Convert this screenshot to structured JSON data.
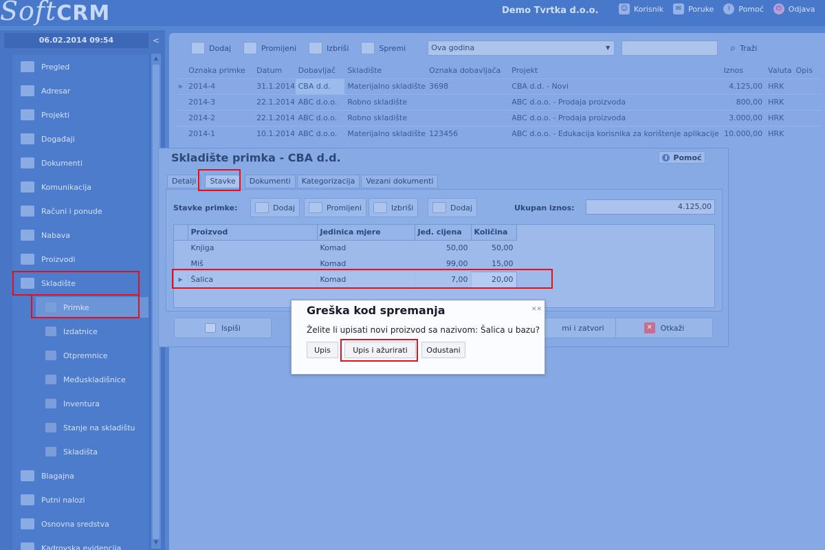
{
  "app": {
    "logo_text": "Soft",
    "logo_accent": "CRM",
    "company": "Demo Tvrtka d.o.o.",
    "top_nav": [
      {
        "label": "Korisnik",
        "icon": "user-icon"
      },
      {
        "label": "Poruke",
        "icon": "messages-icon"
      },
      {
        "label": "Pomoć",
        "icon": "help-icon"
      },
      {
        "label": "Odjava",
        "icon": "logout-icon"
      }
    ]
  },
  "sidebar": {
    "datetime": "06.02.2014 09:54",
    "collapse": "<",
    "items": [
      {
        "label": "Pregled"
      },
      {
        "label": "Adresar"
      },
      {
        "label": "Projekti"
      },
      {
        "label": "Događaji"
      },
      {
        "label": "Dokumenti"
      },
      {
        "label": "Komunikacija"
      },
      {
        "label": "Računi i ponude"
      },
      {
        "label": "Nabava"
      },
      {
        "label": "Proizvodi"
      },
      {
        "label": "Skladište"
      }
    ],
    "subitems": [
      {
        "label": "Primke"
      },
      {
        "label": "Izdatnice"
      },
      {
        "label": "Otpremnice"
      },
      {
        "label": "Međuskladišnice"
      },
      {
        "label": "Inventura"
      },
      {
        "label": "Stanje na skladištu"
      },
      {
        "label": "Skladišta"
      }
    ],
    "items_after": [
      {
        "label": "Blagajna"
      },
      {
        "label": "Putni nalozi"
      },
      {
        "label": "Osnovna sredstva"
      },
      {
        "label": "Kadrovska evidencija"
      }
    ]
  },
  "toolbar": {
    "add": "Dodaj",
    "edit": "Promijeni",
    "delete": "Izbriši",
    "save": "Spremi",
    "period": "Ova godina",
    "search_value": "",
    "search": "Traži"
  },
  "grid": {
    "columns": [
      "Oznaka primke",
      "Datum",
      "Dobavljač",
      "Skladište",
      "Oznaka dobavljača",
      "Projekt",
      "Iznos",
      "Valuta",
      "Opis"
    ],
    "rows": [
      [
        "2014-4",
        "31.1.2014",
        "CBA d.d.",
        "Materijalno skladište",
        "3698",
        "CBA d.d. - Novi",
        "4.125,00",
        "HRK",
        ""
      ],
      [
        "2014-3",
        "22.1.2014",
        "ABC d.o.o.",
        "Robno skladište",
        "",
        "ABC d.o.o. - Prodaja proizvoda",
        "800,00",
        "HRK",
        ""
      ],
      [
        "2014-2",
        "22.1.2014",
        "ABC d.o.o.",
        "Robno skladište",
        "",
        "ABC d.o.o. - Prodaja proizvoda",
        "3.000,00",
        "HRK",
        ""
      ],
      [
        "2014-1",
        "10.1.2014",
        "ABC d.o.o.",
        "Materijalno skladište",
        "123456",
        "ABC d.o.o. - Edukacija korisnika za korištenje aplikacije",
        "10.000,00",
        "HRK",
        ""
      ]
    ]
  },
  "window": {
    "title": "Skladište primka - CBA d.d.",
    "help": "Pomoć",
    "tabs": [
      "Detalji",
      "Stavke",
      "Dokumenti",
      "Kategorizacija",
      "Vezani dokumenti"
    ],
    "stavke_label": "Stavke primke:",
    "buttons": {
      "add": "Dodaj",
      "edit": "Promijeni",
      "delete": "Izbriši",
      "add2": "Dodaj"
    },
    "total_label": "Ukupan iznos:",
    "total_value": "4.125,00",
    "items_columns": [
      "Proizvod",
      "Jedinica mjere",
      "Jed. cijena",
      "Količina"
    ],
    "items": [
      [
        "Knjiga",
        "Komad",
        "50,00",
        "50,00"
      ],
      [
        "Miš",
        "Komad",
        "99,00",
        "15,00"
      ],
      [
        "Šalica",
        "Komad",
        "7,00",
        "20,00"
      ]
    ],
    "footer": {
      "print": "Ispiši",
      "save_close": "mi i zatvori",
      "cancel": "Otkaži"
    }
  },
  "alert": {
    "title": "Greška kod spremanja",
    "message": "Želite li upisati novi proizvod sa nazivom: Šalica u bazu?",
    "buttons": [
      "Upis",
      "Upis i ažurirati",
      "Odustani"
    ]
  }
}
